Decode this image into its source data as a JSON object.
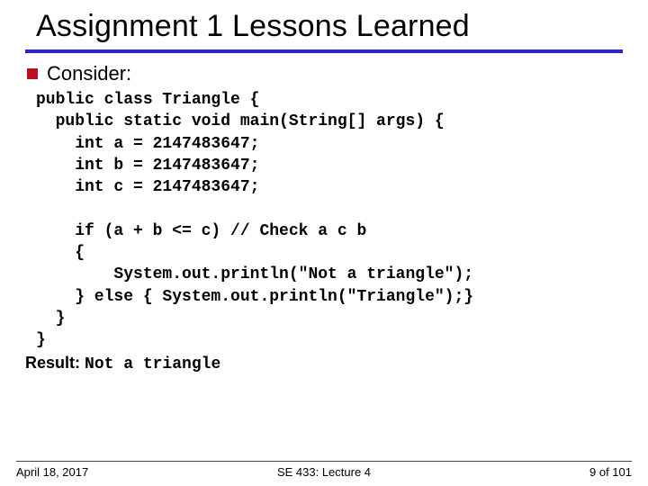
{
  "title": "Assignment 1 Lessons Learned",
  "bullet": {
    "text": "Consider:"
  },
  "code": {
    "l1": "public class Triangle {",
    "l2": "  public static void main(String[] args) {",
    "l3": "    int a = 2147483647;",
    "l4": "    int b = 2147483647;",
    "l5": "    int c = 2147483647;",
    "blank1": "",
    "l6": "    if (a + b <= c) // Check a c b",
    "l7": "    {",
    "l8": "        System.out.println(\"Not a triangle\");",
    "l9": "    } else { System.out.println(\"Triangle\");}",
    "l10": "  }",
    "l11": "}"
  },
  "result": {
    "label": "Result: ",
    "value": "Not a triangle"
  },
  "footer": {
    "date": "April 18, 2017",
    "center": "SE 433: Lecture 4",
    "page": "9 of 101"
  }
}
